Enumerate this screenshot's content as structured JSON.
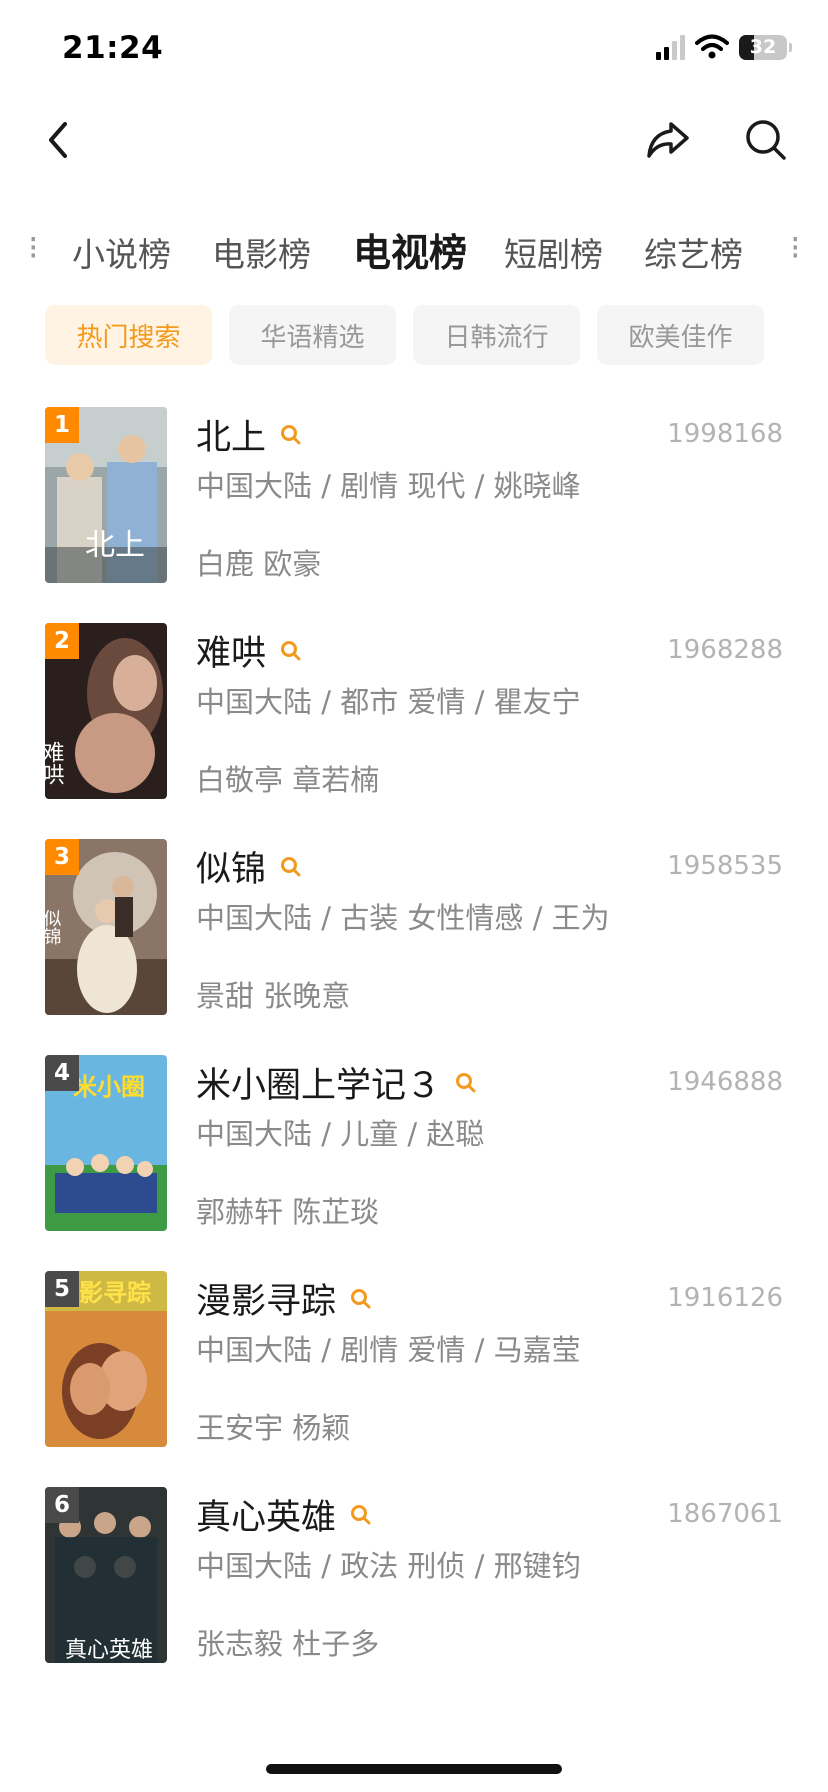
{
  "status_bar": {
    "time": "21:24",
    "battery_level": "32",
    "battery_fraction": 0.32,
    "icons": [
      "signal-icon",
      "wifi-icon",
      "battery-icon"
    ]
  },
  "nav": {
    "icons": [
      "back-arrow-icon",
      "share-icon",
      "search-icon"
    ]
  },
  "category_tabs": [
    {
      "label": "小说榜"
    },
    {
      "label": "电影榜"
    },
    {
      "label": "电视榜",
      "active": true
    },
    {
      "label": "短剧榜"
    },
    {
      "label": "综艺榜"
    }
  ],
  "filters": [
    {
      "label": "热门搜索",
      "active": true
    },
    {
      "label": "华语精选"
    },
    {
      "label": "日韩流行"
    },
    {
      "label": "欧美佳作"
    }
  ],
  "colors": {
    "accent": "#f39a1e",
    "rank_top": "#ff8a00",
    "rank_normal": "#555555"
  },
  "ranking": [
    {
      "rank": "1",
      "title": "北上",
      "count": "1998168",
      "meta": "中国大陆 / 剧情 现代 / 姚晓峰",
      "cast": "白鹿 欧豪"
    },
    {
      "rank": "2",
      "title": "难哄",
      "count": "1968288",
      "meta": "中国大陆 / 都市 爱情 / 瞿友宁",
      "cast": "白敬亭 章若楠"
    },
    {
      "rank": "3",
      "title": "似锦",
      "count": "1958535",
      "meta": "中国大陆 / 古装 女性情感 / 王为",
      "cast": "景甜 张晚意"
    },
    {
      "rank": "4",
      "title": "米小圈上学记３",
      "count": "1946888",
      "meta": "中国大陆 / 儿童 / 赵聪",
      "cast": "郭赫轩 陈芷琰"
    },
    {
      "rank": "5",
      "title": "漫影寻踪",
      "count": "1916126",
      "meta": "中国大陆 / 剧情 爱情 / 马嘉莹",
      "cast": "王安宇 杨颖"
    },
    {
      "rank": "6",
      "title": "真心英雄",
      "count": "1867061",
      "meta": "中国大陆 / 政法 刑侦 / 邢键钧",
      "cast": "张志毅 杜子多"
    }
  ]
}
